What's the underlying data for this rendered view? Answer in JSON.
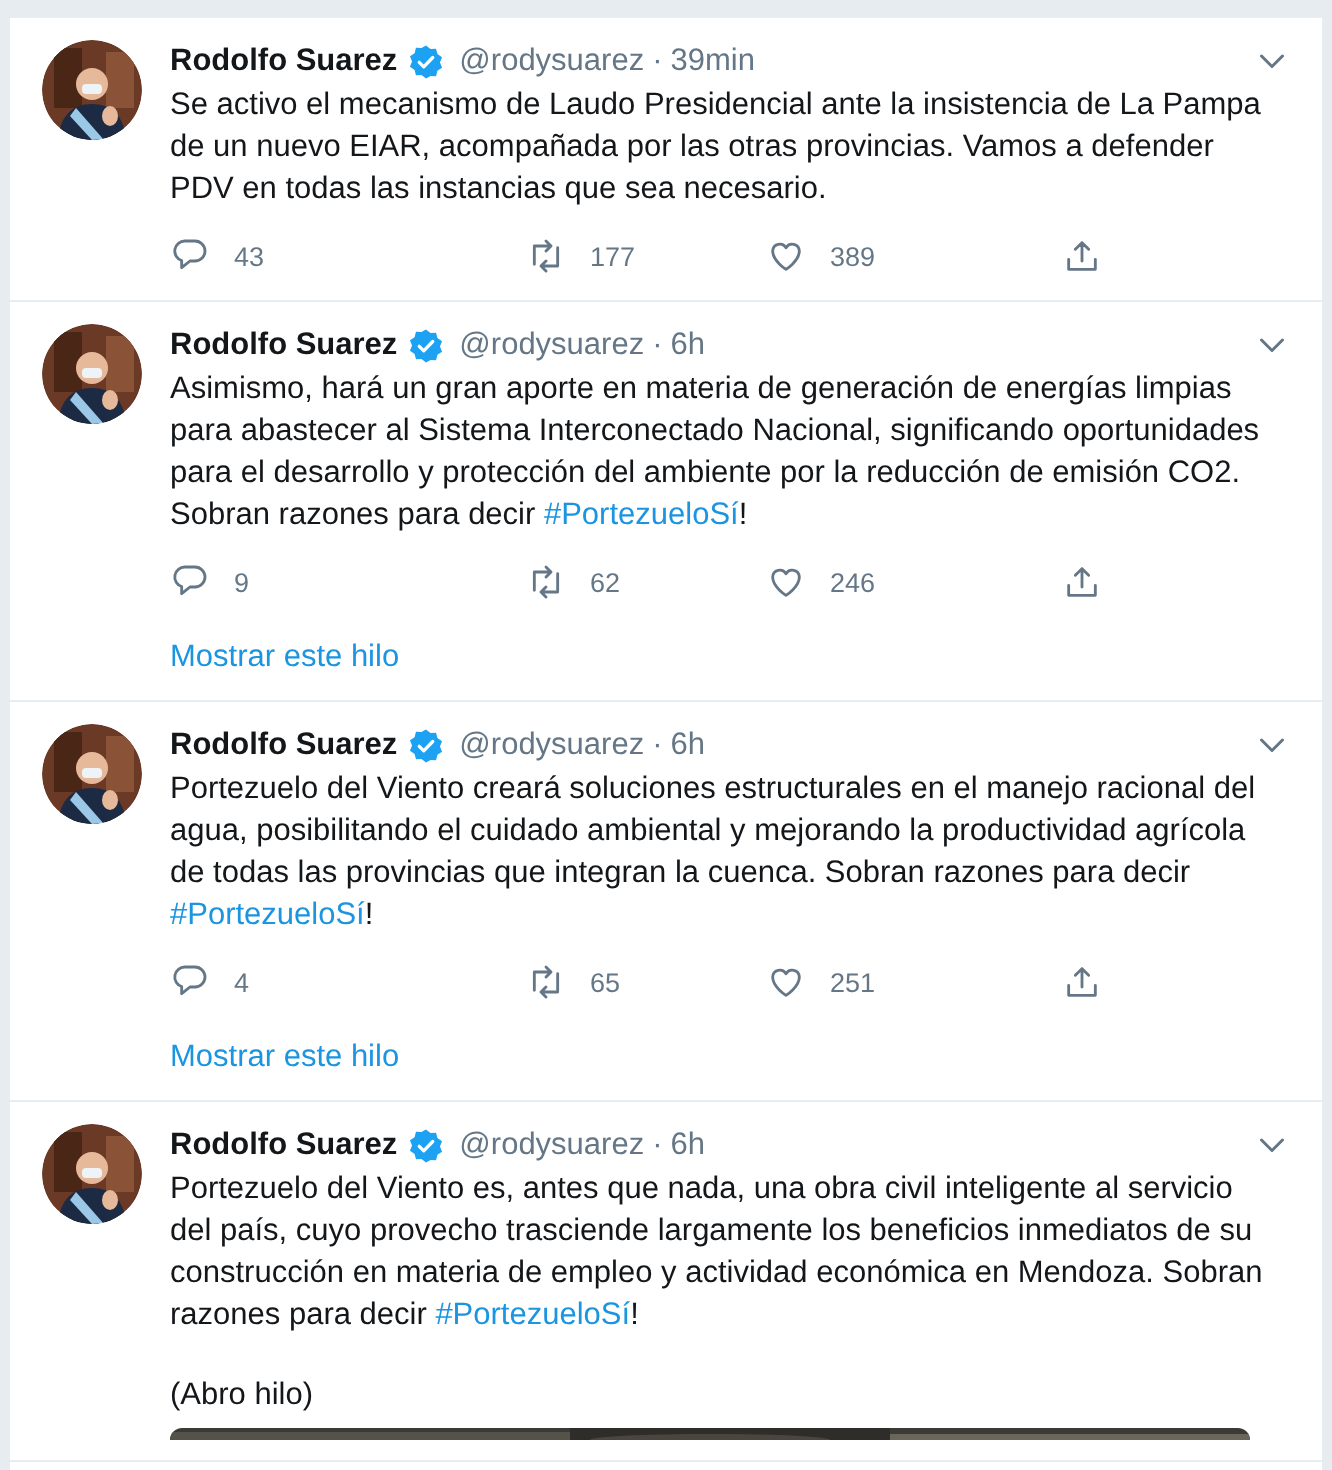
{
  "tweets": [
    {
      "name": "Rodolfo Suarez",
      "verified": true,
      "handle": "@rodysuarez",
      "separator": "·",
      "time": "39min",
      "paragraphs": [
        [
          {
            "text": "Se activo el mecanismo de Laudo Presidencial ante la insistencia de La Pampa de un nuevo EIAR, acompañada por las otras provincias. Vamos a defender PDV en todas las instancias que sea necesario."
          }
        ]
      ],
      "replies": "43",
      "retweets": "177",
      "likes": "389"
    },
    {
      "name": "Rodolfo Suarez",
      "verified": true,
      "handle": "@rodysuarez",
      "separator": "·",
      "time": "6h",
      "paragraphs": [
        [
          {
            "text": "Asimismo, hará un gran aporte en materia de generación de energías limpias para abastecer al Sistema Interconectado Nacional, significando oportunidades para el desarrollo y protección del ambiente por la reducción de emisión CO2. Sobran razones para decir "
          },
          {
            "text": "#PortezueloSí",
            "kind": "hashtag"
          },
          {
            "text": "!"
          }
        ]
      ],
      "replies": "9",
      "retweets": "62",
      "likes": "246",
      "thread_link": "Mostrar este hilo"
    },
    {
      "name": "Rodolfo Suarez",
      "verified": true,
      "handle": "@rodysuarez",
      "separator": "·",
      "time": "6h",
      "paragraphs": [
        [
          {
            "text": "Portezuelo del Viento creará soluciones estructurales en el manejo racional del agua, posibilitando el cuidado ambiental y mejorando la productividad agrícola de todas las provincias que integran la cuenca. Sobran razones para decir "
          },
          {
            "text": "#PortezueloSí",
            "kind": "hashtag"
          },
          {
            "text": "!"
          }
        ]
      ],
      "replies": "4",
      "retweets": "65",
      "likes": "251",
      "thread_link": "Mostrar este hilo"
    },
    {
      "name": "Rodolfo Suarez",
      "verified": true,
      "handle": "@rodysuarez",
      "separator": "·",
      "time": "6h",
      "paragraphs": [
        [
          {
            "text": "Portezuelo del Viento es, antes que nada, una obra civil inteligente al servicio del país, cuyo provecho trasciende largamente los beneficios inmediatos de su construcción en materia de empleo y actividad económica en Mendoza. Sobran razones para decir "
          },
          {
            "text": "#PortezueloSí",
            "kind": "hashtag"
          },
          {
            "text": "!"
          }
        ],
        [
          {
            "text": "(Abro hilo)"
          }
        ]
      ],
      "media": {
        "kind": "picture"
      }
    }
  ]
}
